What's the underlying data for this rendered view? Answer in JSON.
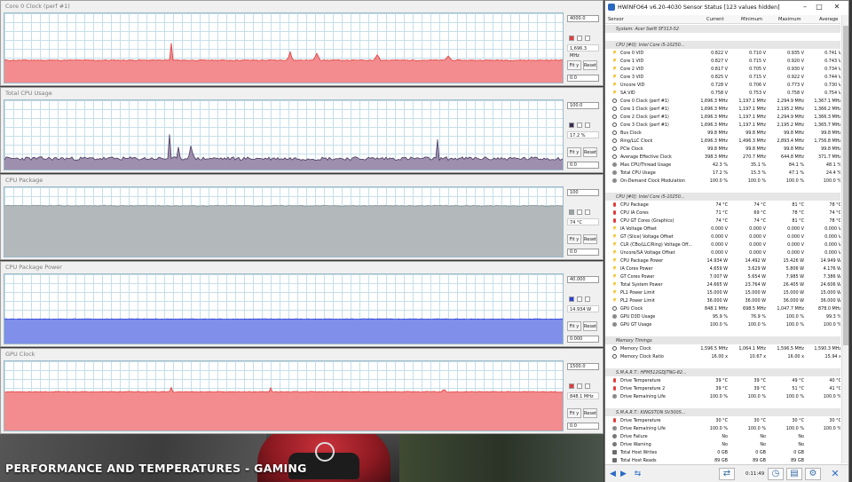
{
  "watermark": "PERFORMANCE AND TEMPERATURES - GAMING",
  "colors": {
    "graph_red": "#f28c8e",
    "graph_red_line": "#e23b3b",
    "graph_purple": "#8f7f9e",
    "graph_gray": "#a8b0b2",
    "graph_blue": "#7f8fea",
    "grid": "#c6dfe9"
  },
  "graphs": [
    {
      "title": "Core 0 Clock (perf #1)",
      "max": "4000.0",
      "current": "1,696.3 MHz",
      "min": "0.0",
      "swatch": "#e23b3b",
      "fit_label": "Fit y",
      "reset_label": "Reset",
      "icons": [
        "color-swatch-icon",
        "checkbox-icon",
        "checkbox-icon"
      ]
    },
    {
      "title": "Total CPU Usage",
      "max": "100.0",
      "current": "17.2 %",
      "min": "0.0",
      "swatch": "#3a2a52",
      "fit_label": "Fit y",
      "reset_label": "Reset"
    },
    {
      "title": "CPU Package",
      "max": "100",
      "current": "74 °C",
      "min": "0.0",
      "swatch": "#9aa4a6",
      "fit_label": "Fit y",
      "reset_label": "Reset"
    },
    {
      "title": "CPU Package Power",
      "max": "40.000",
      "current": "14.934 W",
      "min": "0.000",
      "swatch": "#2c3fd6",
      "fit_label": "Fit y",
      "reset_label": "Reset"
    },
    {
      "title": "GPU Clock",
      "max": "1500.0",
      "current": "848.1 MHz",
      "min": "0.0",
      "swatch": "#e23b3b",
      "fit_label": "Fit y",
      "reset_label": "Reset"
    }
  ],
  "window": {
    "title": "HWiNFO64 v6.20-4030 Sensor Status [123 values hidden]",
    "minimize": "–",
    "maximize": "□",
    "close": "✕",
    "columns": [
      "Sensor",
      "Current",
      "Minimum",
      "Maximum",
      "Average"
    ],
    "elapsed": "0:11:49"
  },
  "sensor_rows": [
    {
      "type": "group",
      "label": "System: Acer Swift SF313-52"
    },
    {
      "type": "blank"
    },
    {
      "type": "group",
      "label": "CPU [#0]: Intel Core i5-10250..."
    },
    {
      "type": "row",
      "icon": "bolt",
      "label": "Core 0 VID",
      "cur": "0.822 V",
      "min": "0.710 V",
      "max": "0.935 V",
      "avg": "0.741 V"
    },
    {
      "type": "row",
      "icon": "bolt",
      "label": "Core 1 VID",
      "cur": "0.827 V",
      "min": "0.715 V",
      "max": "0.920 V",
      "avg": "0.743 V"
    },
    {
      "type": "row",
      "icon": "bolt",
      "label": "Core 2 VID",
      "cur": "0.817 V",
      "min": "0.705 V",
      "max": "0.930 V",
      "avg": "0.734 V"
    },
    {
      "type": "row",
      "icon": "bolt",
      "label": "Core 3 VID",
      "cur": "0.825 V",
      "min": "0.715 V",
      "max": "0.922 V",
      "avg": "0.744 V"
    },
    {
      "type": "row",
      "icon": "bolt",
      "label": "Uncore VID",
      "cur": "0.728 V",
      "min": "0.706 V",
      "max": "0.773 V",
      "avg": "0.730 V"
    },
    {
      "type": "row",
      "icon": "bolt",
      "label": "SA VID",
      "cur": "0.758 V",
      "min": "0.753 V",
      "max": "0.758 V",
      "avg": "0.754 V"
    },
    {
      "type": "row",
      "icon": "clock",
      "label": "Core 0 Clock (perf #1)",
      "cur": "1,696.3 MHz",
      "min": "1,197.1 MHz",
      "max": "2,294.9 MHz",
      "avg": "1,367.1 MHz"
    },
    {
      "type": "row",
      "icon": "clock",
      "label": "Core 1 Clock (perf #1)",
      "cur": "1,696.3 MHz",
      "min": "1,197.1 MHz",
      "max": "2,195.2 MHz",
      "avg": "1,366.2 MHz"
    },
    {
      "type": "row",
      "icon": "clock",
      "label": "Core 2 Clock (perf #1)",
      "cur": "1,696.3 MHz",
      "min": "1,197.1 MHz",
      "max": "2,294.9 MHz",
      "avg": "1,366.3 MHz"
    },
    {
      "type": "row",
      "icon": "clock",
      "label": "Core 3 Clock (perf #1)",
      "cur": "1,696.3 MHz",
      "min": "1,197.1 MHz",
      "max": "2,195.2 MHz",
      "avg": "1,365.7 MHz"
    },
    {
      "type": "row",
      "icon": "clock",
      "label": "Bus Clock",
      "cur": "99.8 MHz",
      "min": "99.8 MHz",
      "max": "99.8 MHz",
      "avg": "99.8 MHz"
    },
    {
      "type": "row",
      "icon": "clock",
      "label": "Ring/LLC Clock",
      "cur": "1,696.3 MHz",
      "min": "1,496.3 MHz",
      "max": "2,893.4 MHz",
      "avg": "1,756.8 MHz"
    },
    {
      "type": "row",
      "icon": "clock",
      "label": "PCIe Clock",
      "cur": "99.8 MHz",
      "min": "99.8 MHz",
      "max": "99.8 MHz",
      "avg": "99.8 MHz"
    },
    {
      "type": "row",
      "icon": "clock",
      "label": "Average Effective Clock",
      "cur": "398.3 MHz",
      "min": "270.7 MHz",
      "max": "644.8 MHz",
      "avg": "371.7 MHz"
    },
    {
      "type": "row",
      "icon": "gear",
      "label": "Max CPU/Thread Usage",
      "cur": "42.3 %",
      "min": "35.1 %",
      "max": "84.1 %",
      "avg": "48.1 %"
    },
    {
      "type": "row",
      "icon": "gear",
      "label": "Total CPU Usage",
      "cur": "17.2 %",
      "min": "15.3 %",
      "max": "47.1 %",
      "avg": "24.4 %"
    },
    {
      "type": "row",
      "icon": "gear",
      "label": "On-Demand Clock Modulation",
      "cur": "100.0 %",
      "min": "100.0 %",
      "max": "100.0 %",
      "avg": "100.0 %"
    },
    {
      "type": "blank"
    },
    {
      "type": "group",
      "label": "CPU [#0]: Intel Core i5-10250..."
    },
    {
      "type": "row",
      "icon": "therm",
      "label": "CPU Package",
      "cur": "74 °C",
      "min": "74 °C",
      "max": "81 °C",
      "avg": "78 °C"
    },
    {
      "type": "row",
      "icon": "therm",
      "label": "CPU IA Cores",
      "cur": "71 °C",
      "min": "69 °C",
      "max": "78 °C",
      "avg": "74 °C"
    },
    {
      "type": "row",
      "icon": "therm",
      "label": "CPU GT Cores (Graphics)",
      "cur": "74 °C",
      "min": "74 °C",
      "max": "81 °C",
      "avg": "78 °C"
    },
    {
      "type": "row",
      "icon": "bolt",
      "label": "IA Voltage Offset",
      "cur": "0.000 V",
      "min": "0.000 V",
      "max": "0.000 V",
      "avg": "0.000 V"
    },
    {
      "type": "row",
      "icon": "bolt",
      "label": "GT (Slice) Voltage Offset",
      "cur": "0.000 V",
      "min": "0.000 V",
      "max": "0.000 V",
      "avg": "0.000 V"
    },
    {
      "type": "row",
      "icon": "bolt",
      "label": "CLR (CBo/LLC/Ring) Voltage Off...",
      "cur": "0.000 V",
      "min": "0.000 V",
      "max": "0.000 V",
      "avg": "0.000 V"
    },
    {
      "type": "row",
      "icon": "bolt",
      "label": "Uncore/SA Voltage Offset",
      "cur": "0.000 V",
      "min": "0.000 V",
      "max": "0.000 V",
      "avg": "0.000 V"
    },
    {
      "type": "row",
      "icon": "bolt",
      "label": "CPU Package Power",
      "cur": "14.934 W",
      "min": "14.492 W",
      "max": "15.426 W",
      "avg": "14.949 W"
    },
    {
      "type": "row",
      "icon": "bolt",
      "label": "IA Cores Power",
      "cur": "4.659 W",
      "min": "3.629 W",
      "max": "5.806 W",
      "avg": "4.176 W"
    },
    {
      "type": "row",
      "icon": "bolt",
      "label": "GT Cores Power",
      "cur": "7.007 W",
      "min": "5.654 W",
      "max": "7.985 W",
      "avg": "7.386 W"
    },
    {
      "type": "row",
      "icon": "bolt",
      "label": "Total System Power",
      "cur": "24.665 W",
      "min": "23.764 W",
      "max": "26.405 W",
      "avg": "24.606 W"
    },
    {
      "type": "row",
      "icon": "bolt",
      "label": "PL1 Power Limit",
      "cur": "15.000 W",
      "min": "15.000 W",
      "max": "15.000 W",
      "avg": "15.000 W"
    },
    {
      "type": "row",
      "icon": "bolt",
      "label": "PL2 Power Limit",
      "cur": "36.000 W",
      "min": "36.000 W",
      "max": "36.000 W",
      "avg": "36.000 W"
    },
    {
      "type": "row",
      "icon": "clock",
      "label": "GPU Clock",
      "cur": "848.1 MHz",
      "min": "698.5 MHz",
      "max": "1,047.7 MHz",
      "avg": "878.0 MHz"
    },
    {
      "type": "row",
      "icon": "gear",
      "label": "GPU D3D Usage",
      "cur": "95.9 %",
      "min": "76.9 %",
      "max": "100.0 %",
      "avg": "99.3 %"
    },
    {
      "type": "row",
      "icon": "gear",
      "label": "GPU GT Usage",
      "cur": "100.0 %",
      "min": "100.0 %",
      "max": "100.0 %",
      "avg": "100.0 %"
    },
    {
      "type": "blank"
    },
    {
      "type": "group",
      "label": "Memory Timings"
    },
    {
      "type": "row",
      "icon": "clock",
      "label": "Memory Clock",
      "cur": "1,596.5 MHz",
      "min": "1,064.1 MHz",
      "max": "1,596.5 MHz",
      "avg": "1,590.3 MHz"
    },
    {
      "type": "row",
      "icon": "clock",
      "label": "Memory Clock Ratio",
      "cur": "16.00 x",
      "min": "10.67 x",
      "max": "16.00 x",
      "avg": "15.94 x"
    },
    {
      "type": "blank"
    },
    {
      "type": "group",
      "label": "S.M.A.R.T.: HFM512GDJTNG-82..."
    },
    {
      "type": "row",
      "icon": "therm",
      "label": "Drive Temperature",
      "cur": "39 °C",
      "min": "39 °C",
      "max": "49 °C",
      "avg": "40 °C"
    },
    {
      "type": "row",
      "icon": "therm",
      "label": "Drive Temperature 2",
      "cur": "39 °C",
      "min": "39 °C",
      "max": "51 °C",
      "avg": "41 °C"
    },
    {
      "type": "row",
      "icon": "gear",
      "label": "Drive Remaining Life",
      "cur": "100.0 %",
      "min": "100.0 %",
      "max": "100.0 %",
      "avg": "100.0 %"
    },
    {
      "type": "blank"
    },
    {
      "type": "group",
      "label": "S.M.A.R.T.: KINGSTON SV300S..."
    },
    {
      "type": "row",
      "icon": "therm",
      "label": "Drive Temperature",
      "cur": "30 °C",
      "min": "30 °C",
      "max": "30 °C",
      "avg": "30 °C"
    },
    {
      "type": "row",
      "icon": "gear",
      "label": "Drive Remaining Life",
      "cur": "100.0 %",
      "min": "100.0 %",
      "max": "100.0 %",
      "avg": "100.0 %"
    },
    {
      "type": "row",
      "icon": "dot",
      "label": "Drive Failure",
      "cur": "No",
      "min": "No",
      "max": "No",
      "avg": ""
    },
    {
      "type": "row",
      "icon": "dot",
      "label": "Drive Warning",
      "cur": "No",
      "min": "No",
      "max": "No",
      "avg": ""
    },
    {
      "type": "row",
      "icon": "chip",
      "label": "Total Host Writes",
      "cur": "0 GB",
      "min": "0 GB",
      "max": "0 GB",
      "avg": ""
    },
    {
      "type": "row",
      "icon": "chip",
      "label": "Total Host Reads",
      "cur": "89 GB",
      "min": "89 GB",
      "max": "89 GB",
      "avg": ""
    }
  ]
}
